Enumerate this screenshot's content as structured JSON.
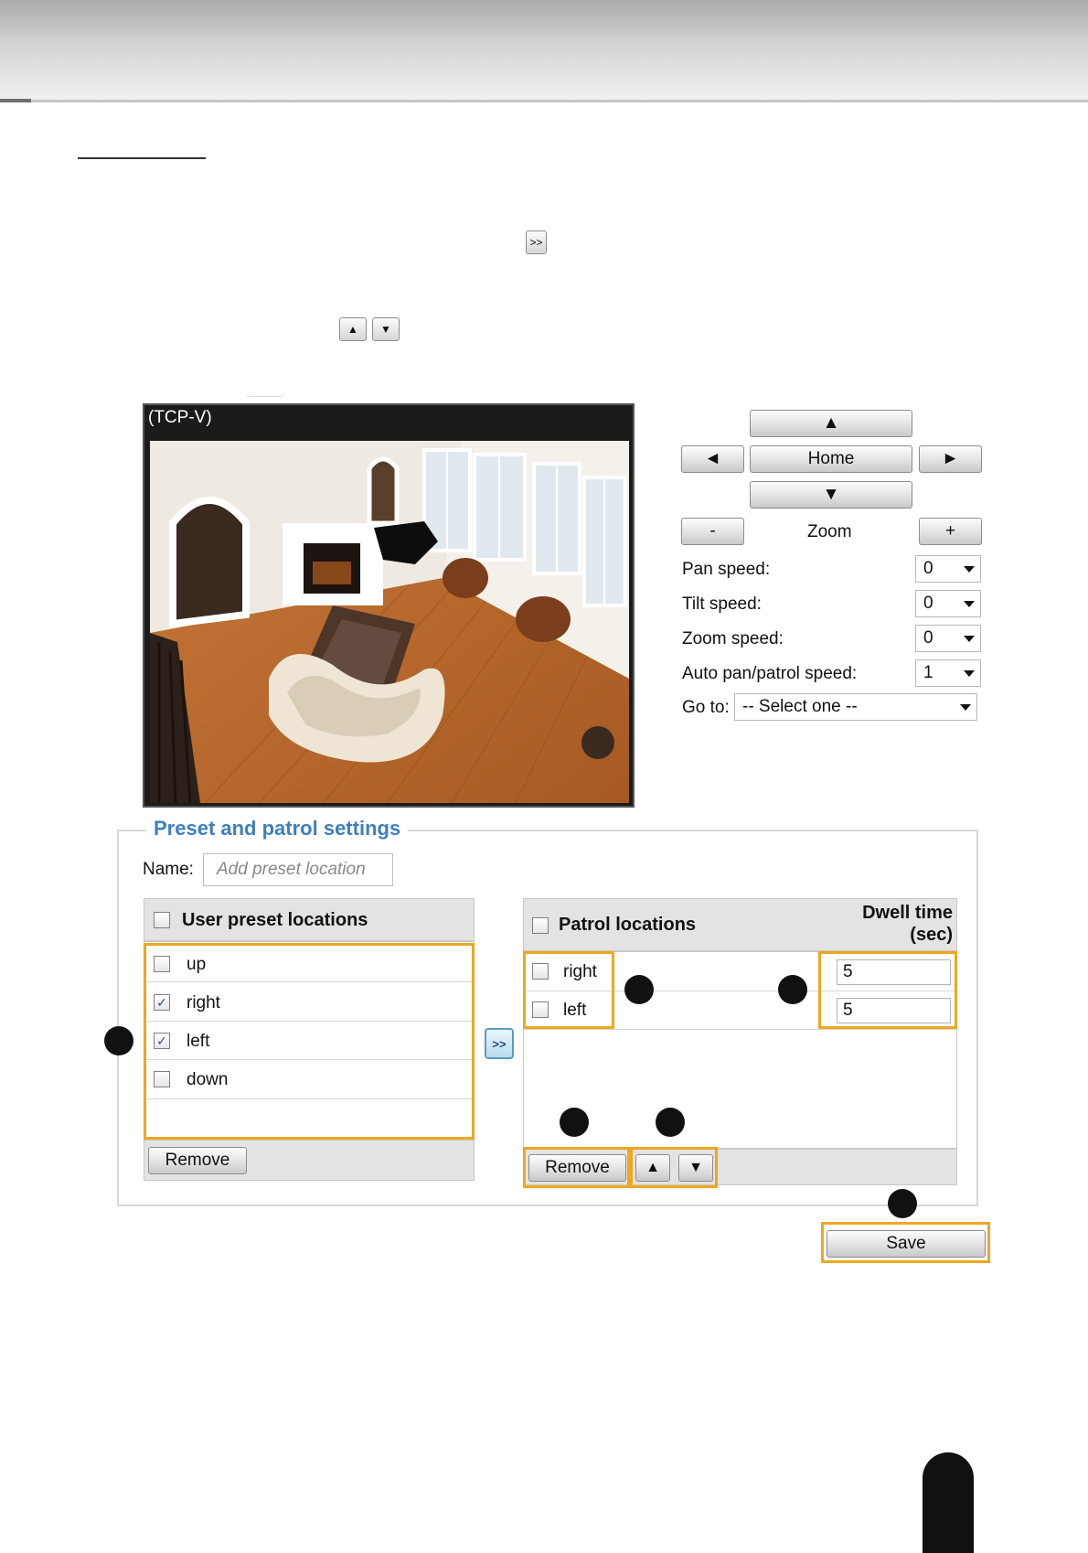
{
  "video": {
    "title": "(TCP-V)"
  },
  "inline_icons": {
    "add_icon": ">>",
    "up_icon": "▲",
    "down_icon": "▼"
  },
  "ptz": {
    "up": "▲",
    "down": "▼",
    "left": "◄",
    "right": "►",
    "home": "Home",
    "zoom_out": "-",
    "zoom_label": "Zoom",
    "zoom_in": "+",
    "pan_speed_label": "Pan speed:",
    "pan_speed": "0",
    "tilt_speed_label": "Tilt speed:",
    "tilt_speed": "0",
    "zoom_speed_label": "Zoom speed:",
    "zoom_speed": "0",
    "auto_speed_label": "Auto pan/patrol speed:",
    "auto_speed": "1",
    "goto_label": "Go to:",
    "goto_value": "-- Select one --"
  },
  "settings": {
    "legend": "Preset and patrol settings",
    "name_label": "Name:",
    "name_placeholder": "Add preset location",
    "preset_header": "User preset locations",
    "presets": [
      {
        "label": "up",
        "checked": false
      },
      {
        "label": "right",
        "checked": true
      },
      {
        "label": "left",
        "checked": true
      },
      {
        "label": "down",
        "checked": false
      }
    ],
    "preset_remove": "Remove",
    "add_button": ">>",
    "patrol_header": "Patrol locations",
    "dwell_header_1": "Dwell time",
    "dwell_header_2": "(sec)",
    "patrol": [
      {
        "label": "right",
        "dwell": "5"
      },
      {
        "label": "left",
        "dwell": "5"
      }
    ],
    "patrol_remove": "Remove",
    "move_up": "▲",
    "move_down": "▼",
    "save": "Save"
  },
  "colors": {
    "highlight": "#f0a71f",
    "legend": "#3d7fc1"
  }
}
